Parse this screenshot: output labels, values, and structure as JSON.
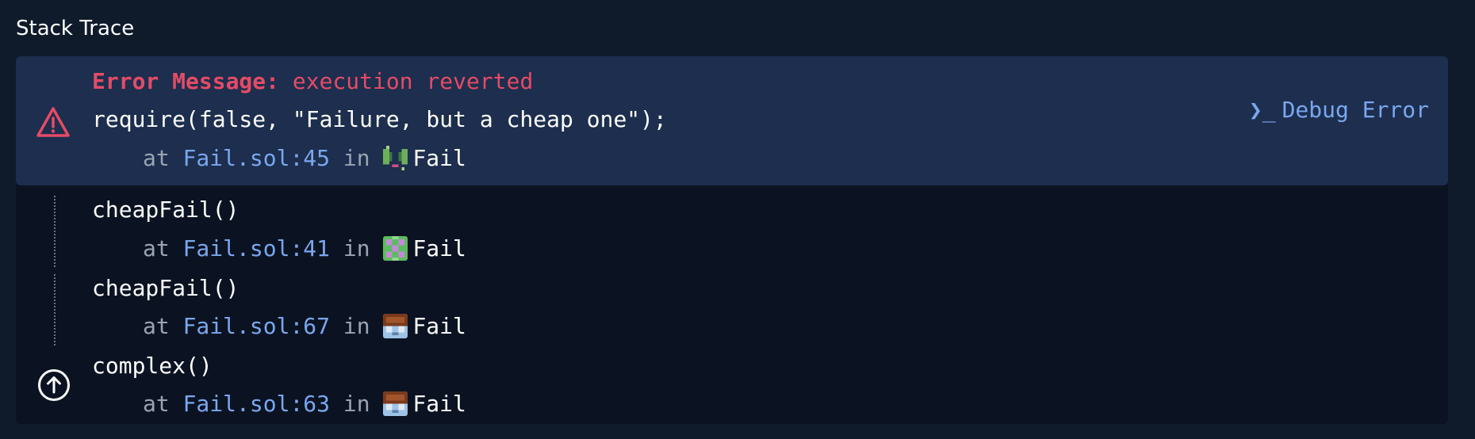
{
  "header": {
    "title": "Stack Trace"
  },
  "error": {
    "label": "Error Message:",
    "message": "execution reverted",
    "code": "require(false, \"Failure, but a cheap one\");",
    "location": {
      "at": "at",
      "file": "Fail.sol:45",
      "in": "in",
      "contract": "Fail"
    },
    "debug_label": "Debug Error",
    "icon": "warning-triangle-icon",
    "color": "#e54b66"
  },
  "frames": [
    {
      "call": "cheapFail()",
      "at": "at",
      "file": "Fail.sol:41",
      "in": "in",
      "contract": "Fail"
    },
    {
      "call": "cheapFail()",
      "at": "at",
      "file": "Fail.sol:67",
      "in": "in",
      "contract": "Fail"
    },
    {
      "call": "complex()",
      "at": "at",
      "file": "Fail.sol:63",
      "in": "in",
      "contract": "Fail"
    }
  ],
  "icons": {
    "scroll_up": "arrow-up-circle-icon",
    "debug": "terminal-prompt-icon"
  },
  "colors": {
    "background": "#0f1a2b",
    "panel": "#0b1322",
    "error_box": "#1d2e4e",
    "link": "#7aa7ee",
    "muted": "#9aa4b2"
  }
}
